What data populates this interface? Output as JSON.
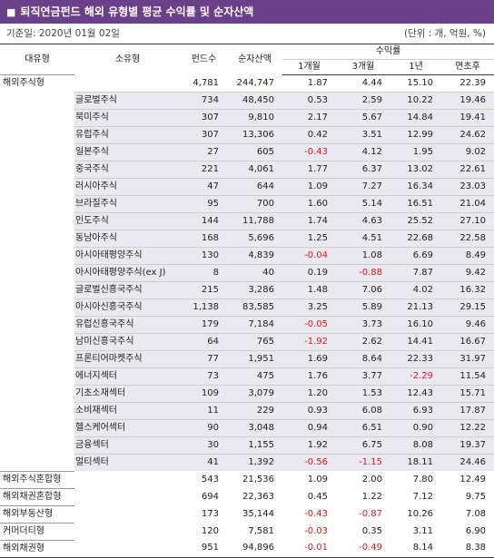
{
  "title": "퇴직연금펀드 해외 유형별 평균 수익률 및 순자산액",
  "base_date": "기준일: 2020년 01월 02일",
  "unit_note": "(단위 : 개, 억원, %)",
  "headers": {
    "main_type": "대유형",
    "sub_type": "소유형",
    "fund_count": "펀드수",
    "net_assets": "순자산액",
    "returns": "수익률",
    "m1": "1개월",
    "m3": "3개월",
    "y1": "1년",
    "ytd": "연초후"
  },
  "rows": [
    {
      "main": "해외주식형",
      "sub": "",
      "funds": "4,781",
      "assets": "244,747",
      "m1": "1.87",
      "m3": "4.44",
      "y1": "15.10",
      "ytd": "22.39"
    },
    {
      "main": "",
      "sub": "글로벌주식",
      "funds": "734",
      "assets": "48,450",
      "m1": "0.53",
      "m3": "2.59",
      "y1": "10.22",
      "ytd": "19.46"
    },
    {
      "main": "",
      "sub": "북미주식",
      "funds": "307",
      "assets": "9,810",
      "m1": "2.17",
      "m3": "5.67",
      "y1": "14.84",
      "ytd": "19.41"
    },
    {
      "main": "",
      "sub": "유럽주식",
      "funds": "307",
      "assets": "13,306",
      "m1": "0.42",
      "m3": "3.51",
      "y1": "12.99",
      "ytd": "24.62"
    },
    {
      "main": "",
      "sub": "일본주식",
      "funds": "27",
      "assets": "605",
      "m1": "-0.43",
      "m3": "4.12",
      "y1": "1.95",
      "ytd": "9.02"
    },
    {
      "main": "",
      "sub": "중국주식",
      "funds": "221",
      "assets": "4,061",
      "m1": "1.77",
      "m3": "6.37",
      "y1": "13.02",
      "ytd": "22.61"
    },
    {
      "main": "",
      "sub": "러시아주식",
      "funds": "47",
      "assets": "644",
      "m1": "1.09",
      "m3": "7.27",
      "y1": "16.34",
      "ytd": "23.03"
    },
    {
      "main": "",
      "sub": "브라질주식",
      "funds": "95",
      "assets": "700",
      "m1": "1.60",
      "m3": "5.14",
      "y1": "16.51",
      "ytd": "21.04"
    },
    {
      "main": "",
      "sub": "인도주식",
      "funds": "144",
      "assets": "11,788",
      "m1": "1.74",
      "m3": "4.63",
      "y1": "25.52",
      "ytd": "27.10"
    },
    {
      "main": "",
      "sub": "동남아주식",
      "funds": "168",
      "assets": "5,696",
      "m1": "1.25",
      "m3": "4.51",
      "y1": "22.68",
      "ytd": "22.58"
    },
    {
      "main": "",
      "sub": "아시아태평양주식",
      "funds": "130",
      "assets": "4,839",
      "m1": "-0.04",
      "m3": "1.08",
      "y1": "6.69",
      "ytd": "8.49"
    },
    {
      "main": "",
      "sub": "아시아태평양주식(ex J)",
      "funds": "8",
      "assets": "40",
      "m1": "0.19",
      "m3": "-0.88",
      "y1": "7.87",
      "ytd": "9.42"
    },
    {
      "main": "",
      "sub": "글로벌신흥국주식",
      "funds": "215",
      "assets": "3,286",
      "m1": "1.48",
      "m3": "7.06",
      "y1": "4.02",
      "ytd": "16.32"
    },
    {
      "main": "",
      "sub": "아시아신흥국주식",
      "funds": "1,138",
      "assets": "83,585",
      "m1": "3.25",
      "m3": "5.89",
      "y1": "21.13",
      "ytd": "29.15"
    },
    {
      "main": "",
      "sub": "유럽신흥국주식",
      "funds": "179",
      "assets": "7,184",
      "m1": "-0.05",
      "m3": "3.73",
      "y1": "16.10",
      "ytd": "9.46"
    },
    {
      "main": "",
      "sub": "남미신흥국주식",
      "funds": "64",
      "assets": "765",
      "m1": "-1.92",
      "m3": "2.62",
      "y1": "14.41",
      "ytd": "16.67"
    },
    {
      "main": "",
      "sub": "프론티어마켓주식",
      "funds": "77",
      "assets": "1,951",
      "m1": "1.69",
      "m3": "8.64",
      "y1": "22.33",
      "ytd": "31.97"
    },
    {
      "main": "",
      "sub": "에너지섹터",
      "funds": "73",
      "assets": "475",
      "m1": "1.76",
      "m3": "3.77",
      "y1": "-2.29",
      "ytd": "11.54"
    },
    {
      "main": "",
      "sub": "기초소재섹터",
      "funds": "109",
      "assets": "3,079",
      "m1": "1.20",
      "m3": "1.53",
      "y1": "12.43",
      "ytd": "15.71"
    },
    {
      "main": "",
      "sub": "소비재섹터",
      "funds": "11",
      "assets": "229",
      "m1": "0.93",
      "m3": "6.08",
      "y1": "6.93",
      "ytd": "17.87"
    },
    {
      "main": "",
      "sub": "헬스케어섹터",
      "funds": "90",
      "assets": "3,048",
      "m1": "0.94",
      "m3": "6.51",
      "y1": "0.90",
      "ytd": "12.22"
    },
    {
      "main": "",
      "sub": "금융섹터",
      "funds": "30",
      "assets": "1,155",
      "m1": "1.92",
      "m3": "6.75",
      "y1": "8.08",
      "ytd": "19.37"
    },
    {
      "main": "",
      "sub": "멀티섹터",
      "funds": "41",
      "assets": "1,392",
      "m1": "-0.56",
      "m3": "-1.15",
      "y1": "18.11",
      "ytd": "24.46"
    },
    {
      "main": "해외주식혼합형",
      "sub": "",
      "funds": "543",
      "assets": "21,536",
      "m1": "1.09",
      "m3": "2.00",
      "y1": "7.80",
      "ytd": "12.49"
    },
    {
      "main": "해외채권혼합형",
      "sub": "",
      "funds": "694",
      "assets": "22,363",
      "m1": "0.45",
      "m3": "1.22",
      "y1": "7.12",
      "ytd": "9.75"
    },
    {
      "main": "해외부동산형",
      "sub": "",
      "funds": "173",
      "assets": "35,144",
      "m1": "-0.43",
      "m3": "-0.87",
      "y1": "10.26",
      "ytd": "7.08"
    },
    {
      "main": "커머더티형",
      "sub": "",
      "funds": "120",
      "assets": "7,581",
      "m1": "-0.03",
      "m3": "0.35",
      "y1": "3.11",
      "ytd": "6.90"
    },
    {
      "main": "해외채권형",
      "sub": "",
      "funds": "951",
      "assets": "94,896",
      "m1": "-0.01",
      "m3": "-0.49",
      "y1": "8.14",
      "ytd": "8.38"
    }
  ]
}
